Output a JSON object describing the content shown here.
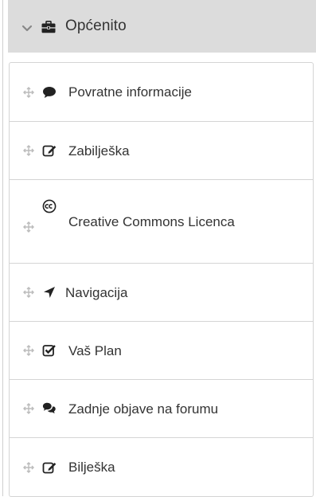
{
  "section": {
    "title": "Općenito",
    "chevron_icon": "chevron-down-icon",
    "section_icon": "briefcase-icon"
  },
  "colors": {
    "header_bg": "#dcdcdc",
    "text": "#333333",
    "icon_dark": "#222222",
    "move_icon": "#bbbbbb",
    "border": "#d4d4d4"
  },
  "blocks": [
    {
      "label": "Povratne informacije",
      "icon": "comment-icon"
    },
    {
      "label": "Zabilješka",
      "icon": "edit-note-icon"
    },
    {
      "label": "Creative Commons Licenca",
      "icon": "creative-commons-icon"
    },
    {
      "label": "Navigacija",
      "icon": "location-arrow-icon"
    },
    {
      "label": "Vaš Plan",
      "icon": "checkbox-checked-icon"
    },
    {
      "label": "Zadnje objave na forumu",
      "icon": "comments-icon"
    },
    {
      "label": "Bilješka",
      "icon": "edit-note-icon"
    }
  ]
}
